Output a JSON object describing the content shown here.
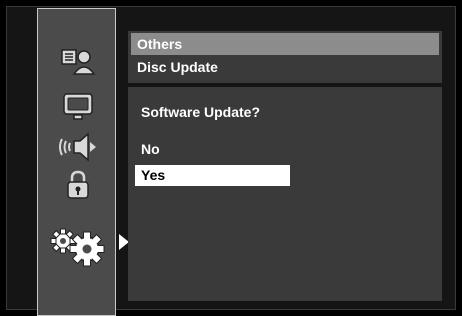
{
  "menu": {
    "category": "Others",
    "item": "Disc Update"
  },
  "dialog": {
    "question": "Software Update?",
    "options": [
      "No",
      "Yes"
    ],
    "selected": "Yes"
  },
  "sidebar": {
    "icons": [
      "language-icon",
      "display-icon",
      "audio-icon",
      "parental-lock-icon",
      "settings-gears-icon"
    ],
    "active": "settings-gears-icon"
  }
}
